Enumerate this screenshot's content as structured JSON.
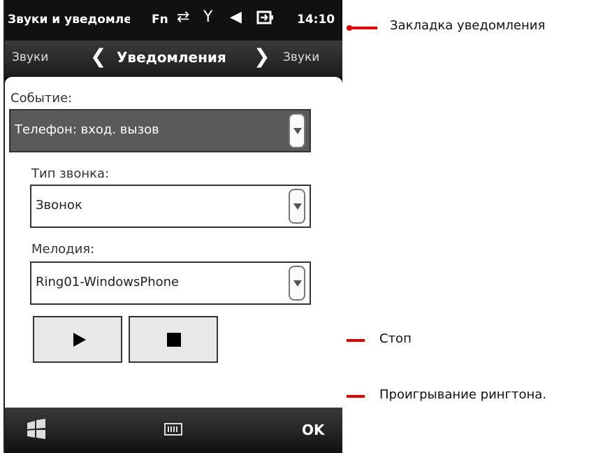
{
  "statusbar": {
    "title": "Звуки и уведомления",
    "fn": "Fn",
    "time": "14:10",
    "icons": [
      "sync-arrows-icon",
      "no-signal-icon",
      "speaker-icon",
      "battery-icon"
    ]
  },
  "tabbar": {
    "left": "Звуки",
    "center": "Уведомления",
    "right": "Звуки",
    "prev_glyph": "❮",
    "next_glyph": "❯"
  },
  "form": {
    "event_label": "Событие:",
    "event_value": "Телефон: вход. вызов",
    "ring_type_label": "Тип звонка:",
    "ring_type_value": "Звонок",
    "melody_label": "Мелодия:",
    "melody_value": "Ring01-WindowsPhone"
  },
  "bottombar": {
    "ok": "OK"
  },
  "annotations": {
    "tab": "Закладка уведомления",
    "stop": "Стоп",
    "play": "Проигрывание рингтона."
  },
  "colors": {
    "annotation": "#e00000",
    "selected_field": "#5a5a5a"
  }
}
